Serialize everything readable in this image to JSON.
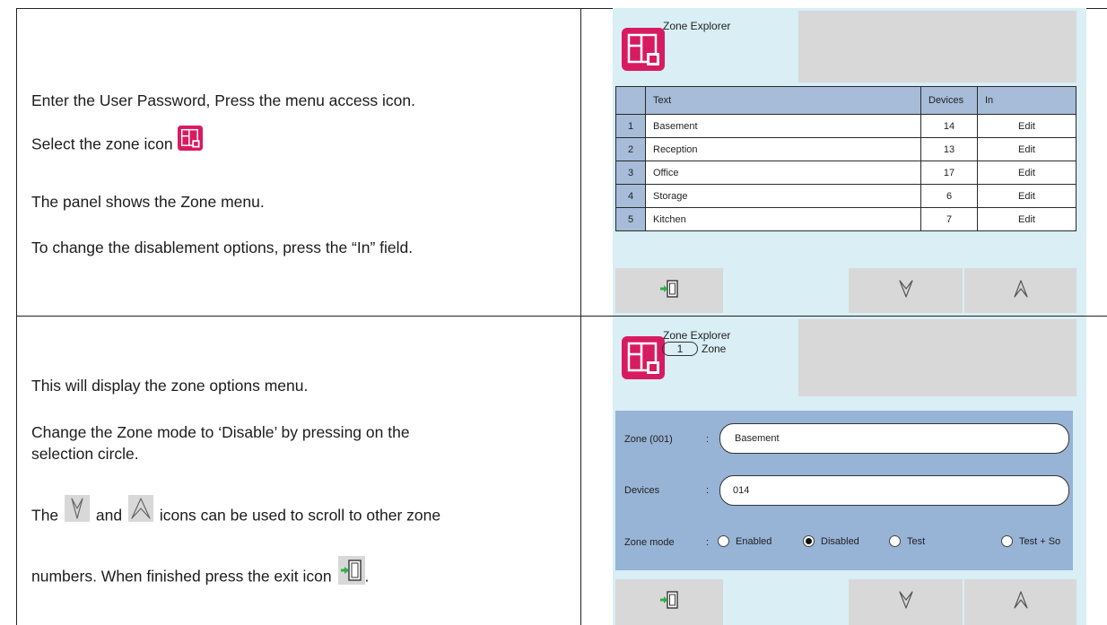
{
  "row1": {
    "line1": "Enter the User Password, Press the menu access icon.",
    "line2": "Select the zone icon",
    "line3": "The panel shows the Zone menu.",
    "line4": "To change the disablement options, press the “In” field."
  },
  "row2": {
    "line1": "This will display the zone options menu.",
    "line2a": "Change the Zone mode to ‘Disable’ by pressing on the",
    "line2b": "selection circle.",
    "line3_the": "The",
    "line3_and": "and",
    "line3_rest": "icons can be used to scroll to other zone",
    "line4": "numbers. When finished press the exit icon",
    "line4_end": "."
  },
  "screen1": {
    "title": "Zone Explorer",
    "headers": {
      "num": "",
      "text": "Text",
      "devices": "Devices",
      "in": "In"
    },
    "rows": [
      {
        "num": "1",
        "text": "Basement",
        "devices": "14",
        "in": "Edit"
      },
      {
        "num": "2",
        "text": "Reception",
        "devices": "13",
        "in": "Edit"
      },
      {
        "num": "3",
        "text": "Office",
        "devices": "17",
        "in": "Edit"
      },
      {
        "num": "4",
        "text": "Storage",
        "devices": "6",
        "in": "Edit"
      },
      {
        "num": "5",
        "text": "Kitchen",
        "devices": "7",
        "in": "Edit"
      }
    ]
  },
  "screen2": {
    "title": "Zone Explorer",
    "zone_number": "1",
    "zone_word": "Zone",
    "zone_label": "Zone (001)",
    "zone_value": "Basement",
    "devices_label": "Devices",
    "devices_value": "014",
    "mode_label": "Zone mode",
    "colon": ":",
    "modes": [
      {
        "label": "Enabled",
        "selected": false
      },
      {
        "label": "Disabled",
        "selected": true
      },
      {
        "label": "Test",
        "selected": false
      },
      {
        "label": "Test + So",
        "selected": false
      }
    ]
  },
  "icons": {
    "zone": "zone-icon",
    "exit": "exit-icon",
    "down": "chevron-down-icon",
    "up": "chevron-up-icon"
  },
  "colors": {
    "zone_icon": "#d81b60",
    "header_blue": "#a6bcd9",
    "options_blue": "#97b3d6",
    "screen_bg": "#d9eef5",
    "exit_green": "#2fae4a"
  }
}
